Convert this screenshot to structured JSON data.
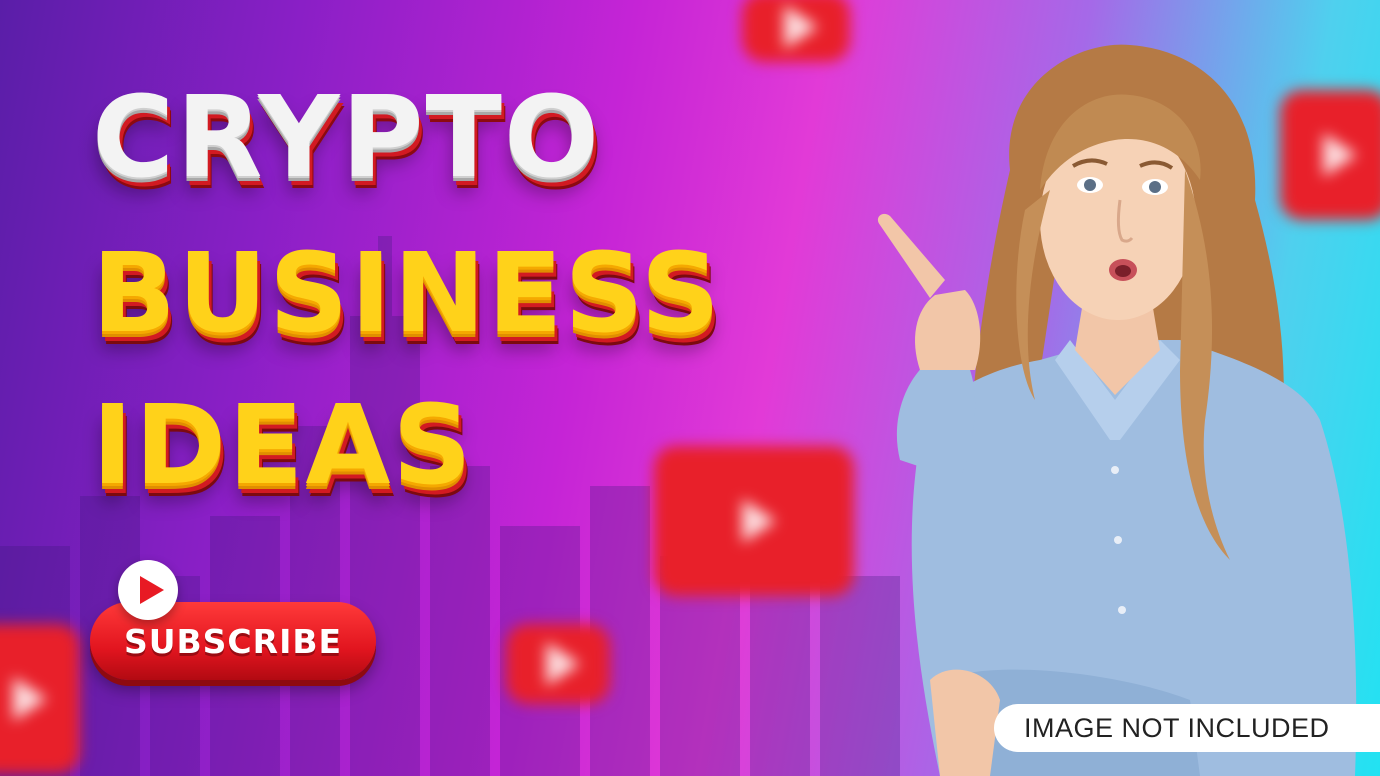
{
  "headline": {
    "line1": "CRYPTO",
    "line2": "BUSINESS",
    "line3": "IDEAS"
  },
  "subscribe": {
    "label": "SUBSCRIBE",
    "icon": "play-icon"
  },
  "notice": {
    "label": "IMAGE NOT INCLUDED"
  },
  "colors": {
    "headline_white": "#f3f3f3",
    "headline_yellow": "#ffd21a",
    "accent_red": "#e2151f",
    "bg_purple": "#5a1ea8",
    "bg_magenta": "#e23ad7",
    "bg_cyan": "#22e2f2"
  }
}
